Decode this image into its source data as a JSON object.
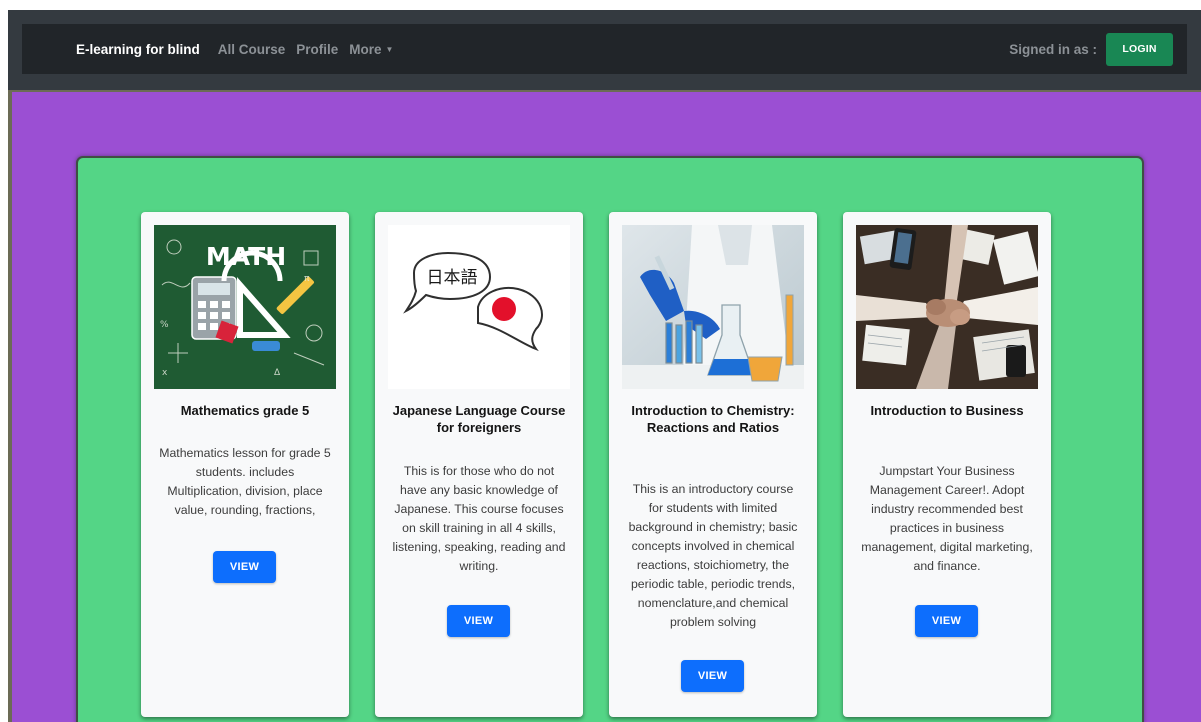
{
  "navbar": {
    "brand": "E-learning for blind",
    "links": [
      "All Course",
      "Profile",
      "More"
    ],
    "signed_in_label": "Signed in as :",
    "login_label": "LOGIN"
  },
  "courses": [
    {
      "title": "Mathematics grade 5",
      "description": "Mathematics lesson for grade 5 students. includes Multiplication, division, place value, rounding, fractions,",
      "button": "VIEW",
      "image_text": "MATH"
    },
    {
      "title": "Japanese Language Course for foreigners",
      "description": "This is for those who do not have any basic knowledge of Japanese. This course focuses on skill training in all 4 skills, listening, speaking, reading and writing.",
      "button": "VIEW",
      "image_text": "日本語"
    },
    {
      "title": "Introduction to Chemistry: Reactions and Ratios",
      "description": "This is an introductory course for students with limited background in chemistry; basic concepts involved in chemical reactions, stoichiometry, the periodic table, periodic trends, nomenclature,and chemical problem solving",
      "button": "VIEW"
    },
    {
      "title": "Introduction to Business",
      "description": "Jumpstart Your Business Management Career!. Adopt industry recommended best practices in business management, digital marketing, and finance.",
      "button": "VIEW"
    }
  ],
  "colors": {
    "navbar": "#212529",
    "page_background": "#9b4fd3",
    "panel_background": "#54d586",
    "login_button": "#198754",
    "view_button": "#0d6efd"
  }
}
